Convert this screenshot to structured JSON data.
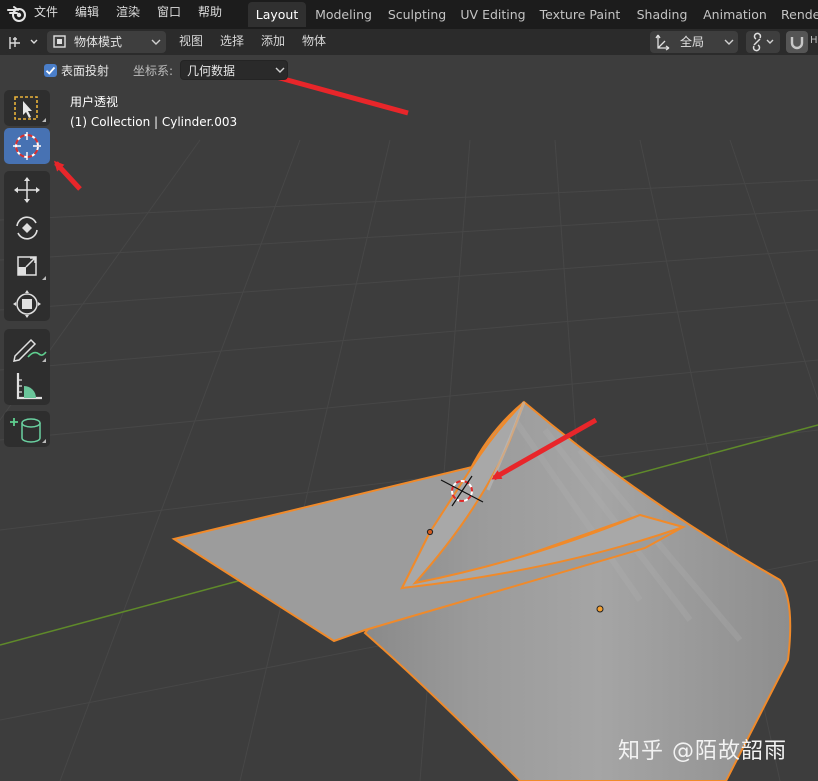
{
  "menu": {
    "items": [
      "文件",
      "编辑",
      "渲染",
      "窗口",
      "帮助"
    ]
  },
  "workspaces": {
    "tabs": [
      "Layout",
      "Modeling",
      "Sculpting",
      "UV Editing",
      "Texture Paint",
      "Shading",
      "Animation",
      "Rende"
    ],
    "active": "Layout"
  },
  "header": {
    "mode": "物体模式",
    "menus": [
      "视图",
      "选择",
      "添加",
      "物体"
    ],
    "transform_orientation": "全局",
    "cut_label": "H"
  },
  "tool_settings": {
    "surface_project_label": "表面投射",
    "surface_project_checked": true,
    "orientation_label": "坐标系:",
    "orientation_value": "几何数据"
  },
  "viewport": {
    "view_name": "用户透视",
    "object_info": "(1) Collection | Cylinder.003"
  },
  "toolbar": {
    "tools": [
      "select-box",
      "cursor",
      "move",
      "rotate",
      "scale",
      "transform",
      "annotate",
      "measure",
      "add-cube"
    ],
    "active": "cursor"
  },
  "colors": {
    "selection_outline": "#f08a2a",
    "active_tool": "#4772b3",
    "arrow": "#e8262a",
    "x_axis": "#8a3a3a",
    "y_axis": "#6a9a2a"
  },
  "watermark": "知乎 @陌故韶雨"
}
